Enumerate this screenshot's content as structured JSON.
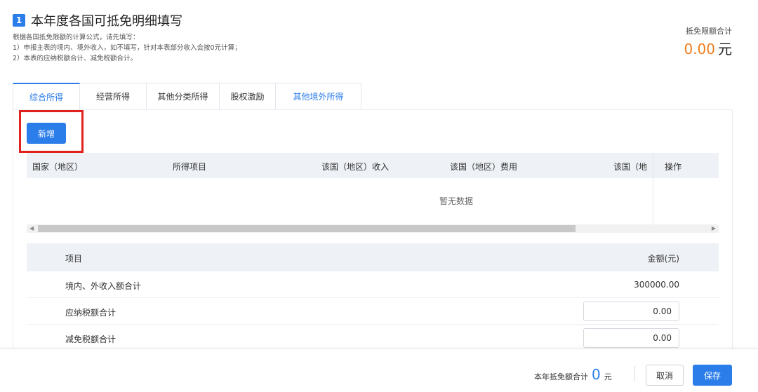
{
  "header": {
    "step": "1",
    "title": "本年度各国可抵免明细填写",
    "desc_lines": [
      "根据各国抵免限额的计算公式，请先填写：",
      "1）申报主表的境内、境外收入，如不填写，针对本表部分收入会按0元计算；",
      "2）本表的应纳税额合计、减免税额合计。"
    ],
    "limit_label": "抵免限额合计",
    "limit_value": "0.00",
    "limit_unit": "元"
  },
  "tabs": [
    "综合所得",
    "经营所得",
    "其他分类所得",
    "股权激励",
    "其他境外所得"
  ],
  "add_button": "新增",
  "data_table": {
    "columns": [
      "国家（地区）",
      "所得项目",
      "该国（地区）收入",
      "该国（地区）费用",
      "该国（地",
      "操作"
    ],
    "empty_text": "暂无数据"
  },
  "summary_table": {
    "headers": [
      "项目",
      "金额(元)"
    ],
    "rows": [
      {
        "label": "境内、外收入额合计",
        "value": "300000.00"
      },
      {
        "label": "应纳税额合计",
        "value": "0.00"
      },
      {
        "label": "减免税额合计",
        "value": "0.00"
      }
    ]
  },
  "footer": {
    "sum_label": "本年抵免额合计",
    "sum_value": "0",
    "sum_unit": "元",
    "cancel": "取消",
    "save": "保存"
  },
  "colors": {
    "accent": "#2b7de9",
    "highlight": "#e0211d",
    "amount": "#f07c1b"
  }
}
